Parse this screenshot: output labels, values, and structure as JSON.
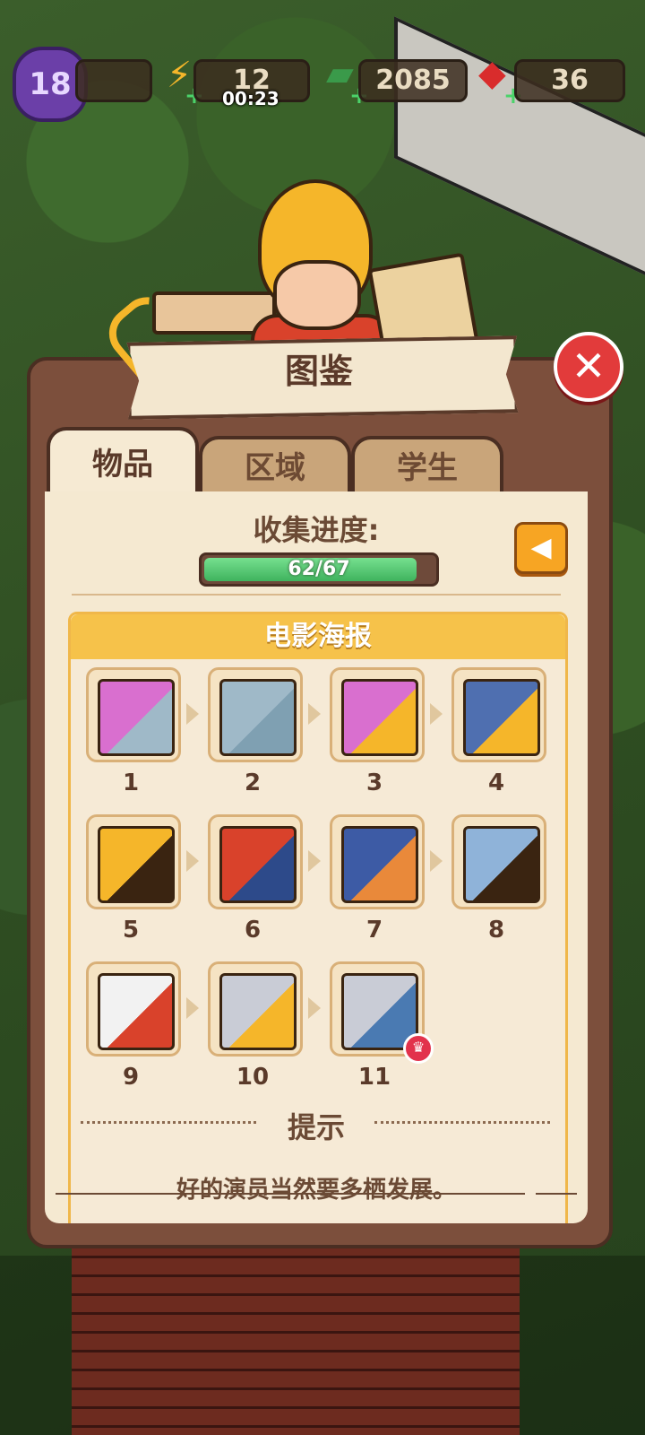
{
  "hud": {
    "level": "18",
    "energy": "12",
    "energy_timer": "00:23",
    "cash": "2085",
    "gems": "36",
    "colors": {
      "level": "#6b3fa8",
      "energy": "#f5b62a",
      "cash": "#3a9a4a",
      "gems": "#d92c2c"
    }
  },
  "panel": {
    "title": "图鉴",
    "tabs": [
      {
        "label": "物品",
        "active": true
      },
      {
        "label": "区域",
        "active": false
      },
      {
        "label": "学生",
        "active": false
      }
    ],
    "progress_label": "收集进度:",
    "progress_text": "62/67",
    "progress_fraction": 0.925,
    "category_title": "电影海报",
    "items": [
      {
        "num": "1"
      },
      {
        "num": "2"
      },
      {
        "num": "3"
      },
      {
        "num": "4"
      },
      {
        "num": "5"
      },
      {
        "num": "6"
      },
      {
        "num": "7"
      },
      {
        "num": "8"
      },
      {
        "num": "9"
      },
      {
        "num": "10"
      },
      {
        "num": "11"
      }
    ],
    "hint_title": "提示",
    "hint_text": "好的演员当然要多栖发展。",
    "close_icon": "close-icon",
    "back_icon": "chevron-left-icon"
  }
}
